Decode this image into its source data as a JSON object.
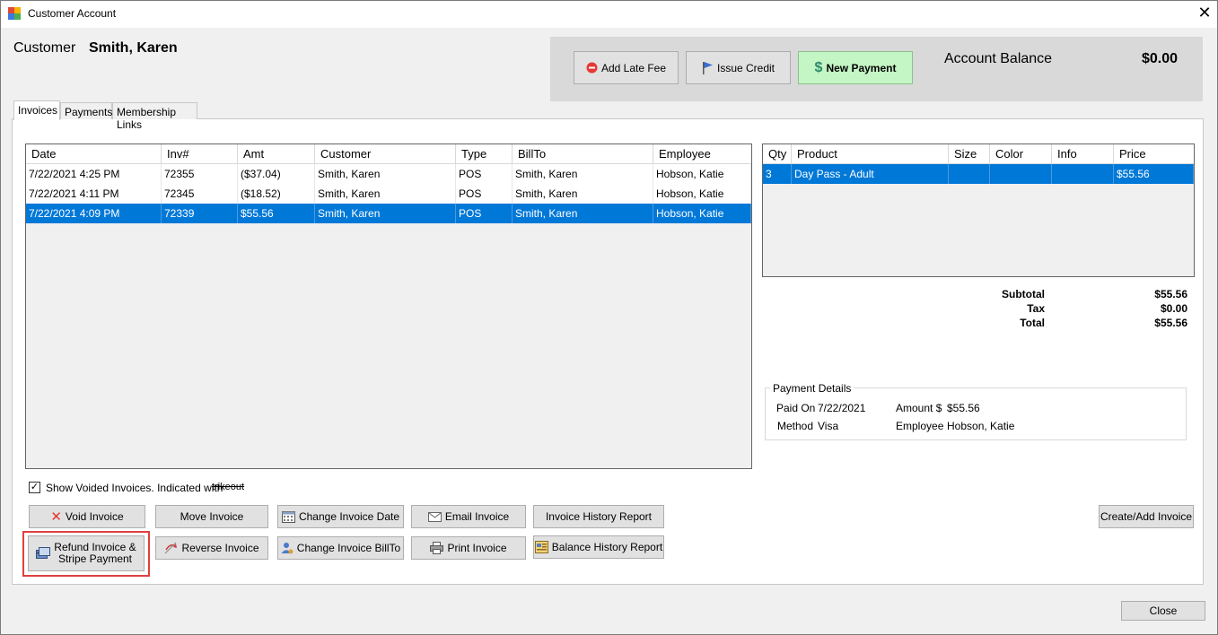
{
  "window": {
    "title": "Customer Account"
  },
  "customer": {
    "label": "Customer",
    "name": "Smith, Karen"
  },
  "actions": {
    "add_late_fee": "Add Late Fee",
    "issue_credit": "Issue Credit",
    "new_payment": "New Payment"
  },
  "balance": {
    "label": "Account Balance",
    "value": "$0.00"
  },
  "tabs": [
    {
      "label": "Invoices",
      "active": true
    },
    {
      "label": "Payments",
      "active": false
    },
    {
      "label": "Membership Links",
      "active": false
    }
  ],
  "invoices": {
    "columns": [
      "Date",
      "Inv#",
      "Amt",
      "Customer",
      "Type",
      "BillTo",
      "Employee"
    ],
    "rows": [
      {
        "date": "7/22/2021 4:25 PM",
        "inv": "72355",
        "amt": "($37.04)",
        "customer": "Smith, Karen",
        "type": "POS",
        "billto": "Smith, Karen",
        "employee": "Hobson, Katie",
        "selected": false
      },
      {
        "date": "7/22/2021 4:11 PM",
        "inv": "72345",
        "amt": "($18.52)",
        "customer": "Smith, Karen",
        "type": "POS",
        "billto": "Smith, Karen",
        "employee": "Hobson, Katie",
        "selected": false
      },
      {
        "date": "7/22/2021 4:09 PM",
        "inv": "72339",
        "amt": "$55.56",
        "customer": "Smith, Karen",
        "type": "POS",
        "billto": "Smith, Karen",
        "employee": "Hobson, Katie",
        "selected": true
      }
    ]
  },
  "items": {
    "columns": [
      "Qty",
      "Product",
      "Size",
      "Color",
      "Info",
      "Price"
    ],
    "rows": [
      {
        "qty": "3",
        "product": "Day Pass - Adult",
        "size": "",
        "color": "",
        "info": "",
        "price": "$55.56",
        "selected": true
      }
    ]
  },
  "totals": {
    "subtotal_label": "Subtotal",
    "subtotal": "$55.56",
    "tax_label": "Tax",
    "tax": "$0.00",
    "total_label": "Total",
    "total": "$55.56"
  },
  "payment_details": {
    "legend": "Payment Details",
    "paid_on_label": "Paid On",
    "paid_on": "7/22/2021",
    "amount_label": "Amount $",
    "amount": "$55.56",
    "method_label": "Method",
    "method": "Visa",
    "employee_label": "Employee",
    "employee": "Hobson, Katie"
  },
  "show_voided": {
    "label": "Show Voided Invoices. Indicated with",
    "strike_text": "trikeout",
    "checked": true
  },
  "buttons": {
    "void_invoice": "Void Invoice",
    "move_invoice": "Move Invoice",
    "change_invoice_date": "Change Invoice Date",
    "email_invoice": "Email Invoice",
    "invoice_history_report": "Invoice History Report",
    "refund_line1": "Refund Invoice &",
    "refund_line2": "Stripe Payment",
    "reverse_invoice": "Reverse Invoice",
    "change_invoice_billto": "Change Invoice BillTo",
    "print_invoice": "Print Invoice",
    "balance_history_report": "Balance History Report",
    "create_add_invoice": "Create/Add Invoice",
    "close": "Close"
  },
  "colors": {
    "selection": "#0078d7",
    "new_payment_bg": "#c4f5c4",
    "highlight": "#e04040"
  }
}
